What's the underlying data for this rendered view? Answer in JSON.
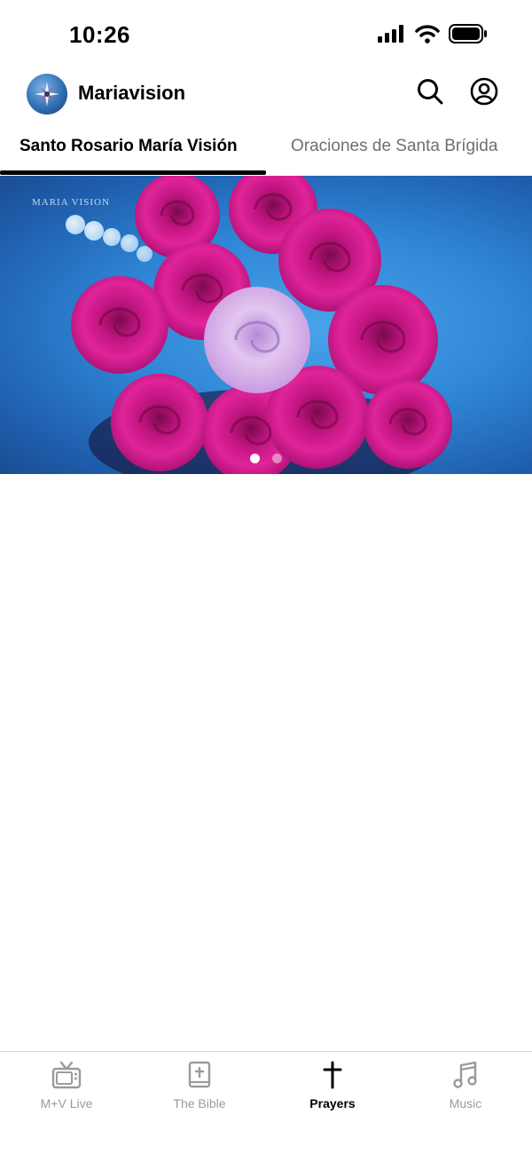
{
  "status_bar": {
    "time": "10:26",
    "icons": [
      "signal-icon",
      "wifi-icon",
      "battery-icon"
    ]
  },
  "header": {
    "title": "Mariavision",
    "logo_icon": "mariavision-logo-icon",
    "actions": [
      "search-icon",
      "profile-icon"
    ]
  },
  "tabs": [
    {
      "label": "Santo Rosario María Visión",
      "active": true
    },
    {
      "label": "Oraciones de Santa Brígida",
      "active": false
    }
  ],
  "carousel": {
    "watermark": "MARIA  VISION",
    "image": "bouquet of magenta roses with one pale pink rose",
    "slide_count": 2,
    "current_slide": 1
  },
  "tab_bar": {
    "items": [
      {
        "label": "M+V Live",
        "icon": "tv-icon",
        "selected": false
      },
      {
        "label": "The Bible",
        "icon": "bible-icon",
        "selected": false
      },
      {
        "label": "Prayers",
        "icon": "cross-icon",
        "selected": true
      },
      {
        "label": "Music",
        "icon": "music-note-icon",
        "selected": false
      }
    ]
  },
  "colors": {
    "accent": "#000000",
    "inactive_text": "#6f6f6f",
    "tab_inactive": "#9a9a9a",
    "banner_blue": "#2f86d6",
    "rose_magenta": "#d6148c"
  }
}
